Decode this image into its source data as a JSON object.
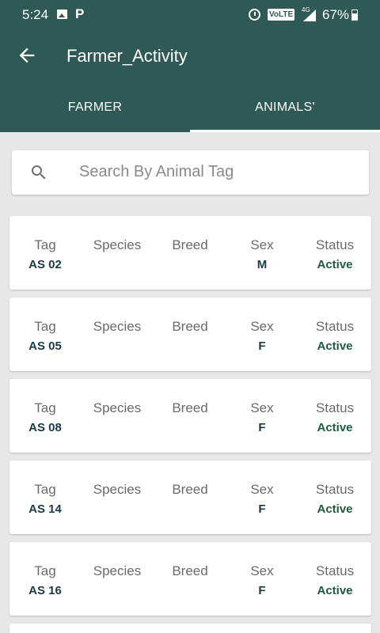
{
  "status_bar": {
    "time": "5:24",
    "p_icon": "P",
    "volte": "VoLTE",
    "network": "4G",
    "battery": "67%"
  },
  "app_bar": {
    "title": "Farmer_Activity"
  },
  "tabs": [
    {
      "label": "FARMER",
      "selected": false
    },
    {
      "label": "ANIMALS'",
      "selected": true
    }
  ],
  "search": {
    "placeholder": "Search By Animal Tag"
  },
  "columns": [
    "Tag",
    "Species",
    "Breed",
    "Sex",
    "Status"
  ],
  "animals": [
    {
      "tag": "AS 02",
      "species": "",
      "breed": "",
      "sex": "M",
      "status": "Active"
    },
    {
      "tag": "AS 05",
      "species": "",
      "breed": "",
      "sex": "F",
      "status": "Active"
    },
    {
      "tag": "AS 08",
      "species": "",
      "breed": "",
      "sex": "F",
      "status": "Active"
    },
    {
      "tag": "AS 14",
      "species": "",
      "breed": "",
      "sex": "F",
      "status": "Active"
    },
    {
      "tag": "AS 16",
      "species": "",
      "breed": "",
      "sex": "F",
      "status": "Active"
    }
  ],
  "colors": {
    "primary": "#2e5954",
    "background": "#e8e7e8",
    "status_active": "#1f5a3f"
  }
}
